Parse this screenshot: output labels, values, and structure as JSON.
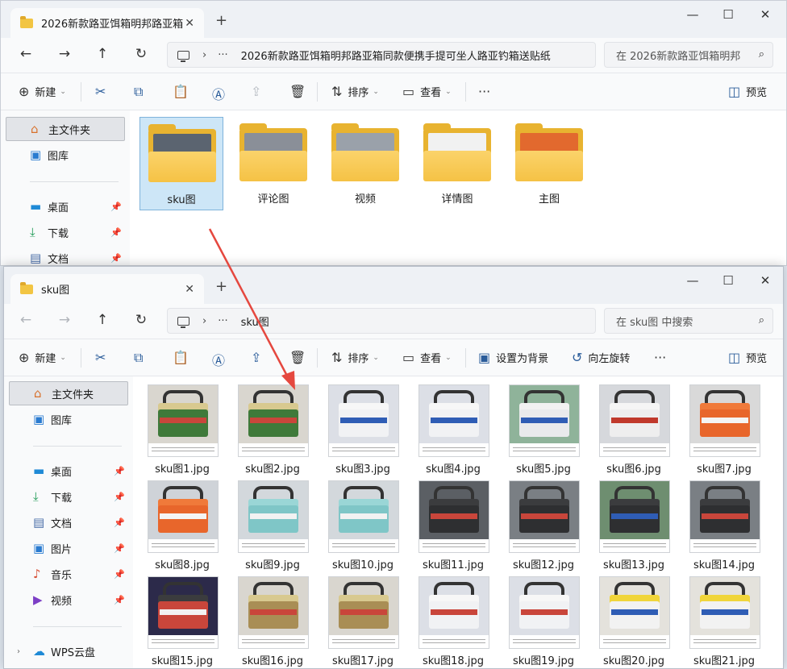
{
  "window1": {
    "tab_title": "2026新款路亚饵箱明邦路亚箱",
    "address_path": "2026新款路亚饵箱明邦路亚箱同款便携手提可坐人路亚钓箱送贴纸",
    "search_placeholder": "在 2026新款路亚饵箱明邦",
    "toolbar": {
      "new": "新建",
      "sort": "排序",
      "view": "查看",
      "preview": "预览"
    },
    "sidebar": [
      {
        "label": "主文件夹",
        "icon": "home-icon"
      },
      {
        "label": "图库",
        "icon": "gallery-icon"
      },
      {
        "label": "桌面",
        "icon": "desktop-icon"
      },
      {
        "label": "下载",
        "icon": "download-icon"
      },
      {
        "label": "文档",
        "icon": "document-icon"
      }
    ],
    "folders": [
      {
        "name": "sku图",
        "paper": "#5b6470"
      },
      {
        "name": "评论图",
        "paper": "#8a8f98"
      },
      {
        "name": "视频",
        "paper": "#9aa1aa"
      },
      {
        "name": "详情图",
        "paper": "#f1f1f1"
      },
      {
        "name": "主图",
        "paper": "#e2692e"
      }
    ]
  },
  "window2": {
    "tab_title": "sku图",
    "address_path": "sku图",
    "search_placeholder": "在 sku图 中搜索",
    "toolbar": {
      "new": "新建",
      "sort": "排序",
      "view": "查看",
      "set_bg": "设置为背景",
      "rotate_left": "向左旋转",
      "preview": "预览"
    },
    "sidebar": [
      {
        "label": "主文件夹",
        "icon": "home-icon"
      },
      {
        "label": "图库",
        "icon": "gallery-icon"
      },
      {
        "label": "桌面",
        "icon": "desktop-icon"
      },
      {
        "label": "下载",
        "icon": "download-icon"
      },
      {
        "label": "文档",
        "icon": "document-icon"
      },
      {
        "label": "图片",
        "icon": "pictures-icon"
      },
      {
        "label": "音乐",
        "icon": "music-icon"
      },
      {
        "label": "视频",
        "icon": "video-icon"
      },
      {
        "label": "WPS云盘",
        "icon": "cloud-icon"
      }
    ],
    "files": [
      {
        "name": "sku图1.jpg",
        "bg": "#d9d6cf",
        "body": "#3f7a3a",
        "lid": "#d8c98f",
        "stripe": "#c9463b"
      },
      {
        "name": "sku图2.jpg",
        "bg": "#d9d6cf",
        "body": "#3f7a3a",
        "lid": "#d8c98f",
        "stripe": "#c9463b"
      },
      {
        "name": "sku图3.jpg",
        "bg": "#dcdfe6",
        "body": "#f1f2f4",
        "lid": "#f7f7f7",
        "stripe": "#2f5db5"
      },
      {
        "name": "sku图4.jpg",
        "bg": "#dcdfe6",
        "body": "#f1f2f4",
        "lid": "#f7f7f7",
        "stripe": "#2f5db5"
      },
      {
        "name": "sku图5.jpg",
        "bg": "#8fb39a",
        "body": "#e9eaec",
        "lid": "#f2f2f2",
        "stripe": "#2f5db5"
      },
      {
        "name": "sku图6.jpg",
        "bg": "#d6d8dc",
        "body": "#eeeeee",
        "lid": "#f5f5f5",
        "stripe": "#c0392b"
      },
      {
        "name": "sku图7.jpg",
        "bg": "#d9d9d9",
        "body": "#e8662b",
        "lid": "#f07a3a",
        "stripe": "#f4f4f4"
      },
      {
        "name": "sku图8.jpg",
        "bg": "#cfd3d8",
        "body": "#e8662b",
        "lid": "#f07a3a",
        "stripe": "#f4f4f4"
      },
      {
        "name": "sku图9.jpg",
        "bg": "#d3d8dc",
        "body": "#7fc6c7",
        "lid": "#9ad6d6",
        "stripe": "#f2f2f2"
      },
      {
        "name": "sku图10.jpg",
        "bg": "#d3d8dc",
        "body": "#7fc6c7",
        "lid": "#9ad6d6",
        "stripe": "#f2f2f2"
      },
      {
        "name": "sku图11.jpg",
        "bg": "#5b5f64",
        "body": "#2e2f31",
        "lid": "#3b3c3e",
        "stripe": "#c9463b"
      },
      {
        "name": "sku图12.jpg",
        "bg": "#7a7f84",
        "body": "#2e2f31",
        "lid": "#3b3c3e",
        "stripe": "#c9463b"
      },
      {
        "name": "sku图13.jpg",
        "bg": "#6e8e70",
        "body": "#2e2f31",
        "lid": "#3b3c3e",
        "stripe": "#2f5db5"
      },
      {
        "name": "sku图14.jpg",
        "bg": "#7a7f84",
        "body": "#2e2f31",
        "lid": "#3b3c3e",
        "stripe": "#c9463b"
      },
      {
        "name": "sku图15.jpg",
        "bg": "#2c2a4a",
        "body": "#c9463b",
        "lid": "#3b3c3e",
        "stripe": "#f2f2f2"
      },
      {
        "name": "sku图16.jpg",
        "bg": "#d9d6cf",
        "body": "#a98e55",
        "lid": "#d8c98f",
        "stripe": "#c9463b"
      },
      {
        "name": "sku图17.jpg",
        "bg": "#d9d6cf",
        "body": "#a98e55",
        "lid": "#d8c98f",
        "stripe": "#c9463b"
      },
      {
        "name": "sku图18.jpg",
        "bg": "#dcdfe6",
        "body": "#f1f2f4",
        "lid": "#f7f7f7",
        "stripe": "#c9463b"
      },
      {
        "name": "sku图19.jpg",
        "bg": "#dcdfe6",
        "body": "#f1f2f4",
        "lid": "#f7f7f7",
        "stripe": "#c9463b"
      },
      {
        "name": "sku图20.jpg",
        "bg": "#e4e2dc",
        "body": "#f2f2f2",
        "lid": "#f0d53a",
        "stripe": "#2f5db5"
      },
      {
        "name": "sku图21.jpg",
        "bg": "#e4e2dc",
        "body": "#f2f2f2",
        "lid": "#f0d53a",
        "stripe": "#2f5db5"
      }
    ]
  },
  "annotation": {
    "arrow_color": "#e5483f"
  }
}
